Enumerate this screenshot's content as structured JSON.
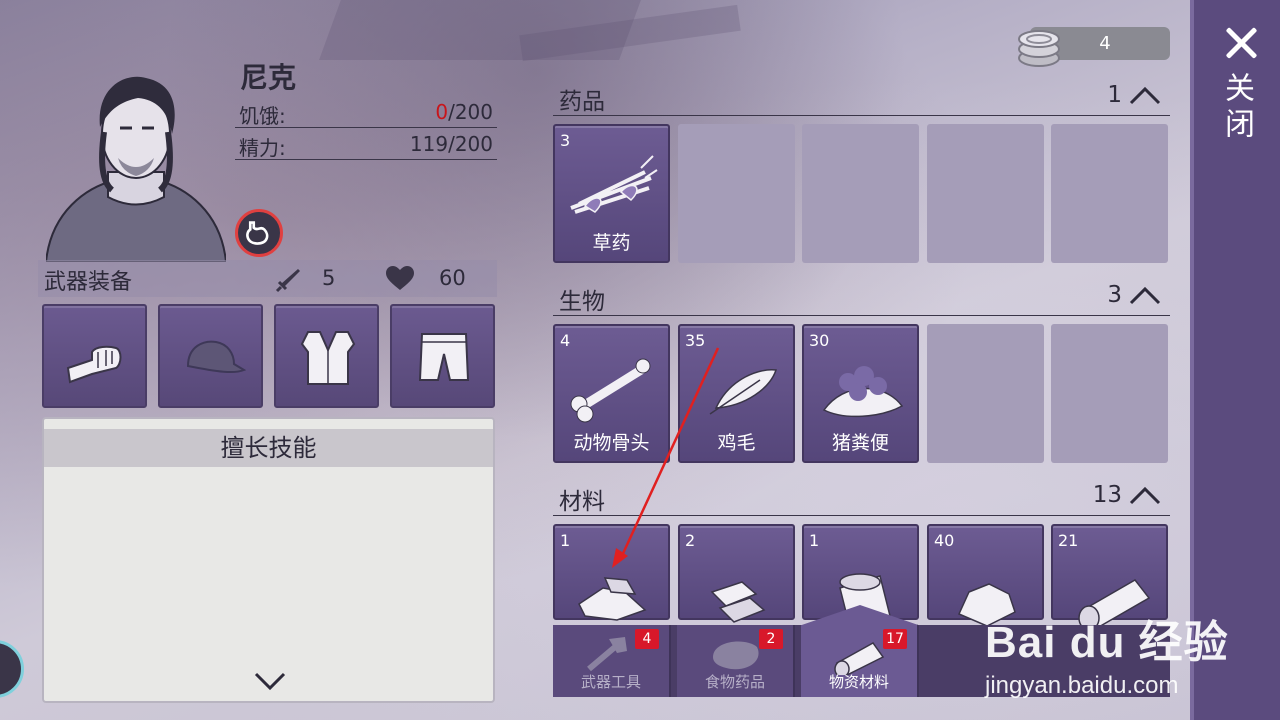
{
  "currency": {
    "amount": "4",
    "icon": "coin-stack-icon"
  },
  "close": {
    "label": "关闭"
  },
  "character": {
    "name": "尼克",
    "hunger_label": "饥饿:",
    "hunger_current": "0",
    "hunger_max": "/200",
    "energy_label": "精力:",
    "energy_value": "119/200"
  },
  "equipment": {
    "title": "武器装备",
    "attack": "5",
    "health": "60",
    "slots": [
      "fist-icon",
      "cap-icon",
      "vest-icon",
      "shorts-icon"
    ]
  },
  "skills": {
    "title": "擅长技能"
  },
  "inventory": {
    "medicine": {
      "title": "药品",
      "count": "1",
      "items": [
        {
          "qty": "3",
          "label": "草药",
          "icon": "herb-icon"
        }
      ]
    },
    "creatures": {
      "title": "生物",
      "count": "3",
      "items": [
        {
          "qty": "4",
          "label": "动物骨头",
          "icon": "bone-icon"
        },
        {
          "qty": "35",
          "label": "鸡毛",
          "icon": "feather-icon"
        },
        {
          "qty": "30",
          "label": "猪粪便",
          "icon": "dung-icon"
        }
      ]
    },
    "materials": {
      "title": "材料",
      "count": "13",
      "items": [
        {
          "qty": "1",
          "label": "",
          "icon": "cloth-scraps-icon"
        },
        {
          "qty": "2",
          "label": "",
          "icon": "metal-ingot-icon"
        },
        {
          "qty": "1",
          "label": "",
          "icon": "pipe-icon"
        },
        {
          "qty": "40",
          "label": "",
          "icon": "stone-icon"
        },
        {
          "qty": "21",
          "label": "",
          "icon": "log-icon"
        }
      ]
    }
  },
  "tabs": [
    {
      "label": "武器工具",
      "badge": "4",
      "icon": "tools-icon",
      "active": false
    },
    {
      "label": "食物药品",
      "badge": "2",
      "icon": "meat-icon",
      "active": false
    },
    {
      "label": "物资材料",
      "badge": "17",
      "icon": "log-icon",
      "active": true
    }
  ],
  "watermark": {
    "line1": "Bai du 经验",
    "line2": "jingyan.baidu.com"
  },
  "colors": {
    "accent": "#5b4b7e",
    "slot": "#6b5a90",
    "danger": "#c8151b",
    "badge": "#d8182a"
  }
}
